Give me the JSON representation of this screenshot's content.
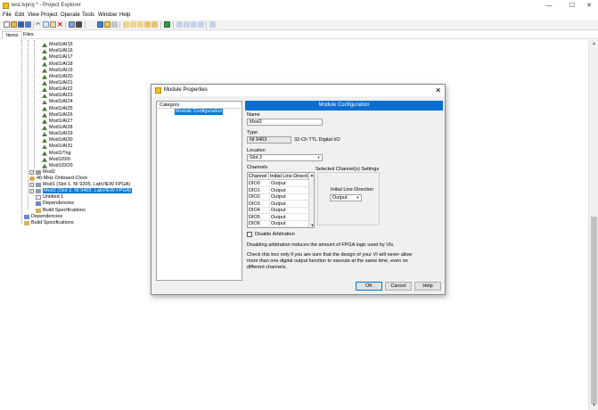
{
  "window": {
    "title": "test.lvproj * - Project Explorer",
    "minimize": "—",
    "maximize": "☐",
    "close": "✕"
  },
  "menu": [
    "File",
    "Edit",
    "View",
    "Project",
    "Operate",
    "Tools",
    "Window",
    "Help"
  ],
  "tabs": [
    "Items",
    "Files"
  ],
  "tree": {
    "channels": [
      "Mod1/AI15",
      "Mod1/AI16",
      "Mod1/AI17",
      "Mod1/AI18",
      "Mod1/AI19",
      "Mod1/AI20",
      "Mod1/AI21",
      "Mod1/AI22",
      "Mod1/AI23",
      "Mod1/AI24",
      "Mod1/AI25",
      "Mod1/AI26",
      "Mod1/AI27",
      "Mod1/AI28",
      "Mod1/AI29",
      "Mod1/AI30",
      "Mod1/AI31",
      "Mod1/Trig",
      "Mod1/DI0",
      "Mod1/DO0"
    ],
    "mod2": "Mod2",
    "clock": "40 MHz Onboard Clock",
    "mod1": "Mod1 (Slot 1, NI 9205, LabVIEW FPGA)",
    "mod2_selected": "Mod2 (Slot 2, NI 9403, LabVIEW FPGA)",
    "untitled": "Untitled 1",
    "dependencies": "Dependencies",
    "build_specs": "Build Specifications",
    "dependencies_root": "Dependencies",
    "build_specs_root": "Build Specifications"
  },
  "dialog": {
    "title": "Module Properties",
    "close": "✕",
    "category_header": "Category",
    "category_item": "Module Configuration",
    "section_title": "Module Configuration",
    "name_label": "Name",
    "name_value": "Mod2",
    "type_label": "Type",
    "type_value": "NI 9403",
    "type_desc": "32-Ch TTL Digital I/O",
    "location_label": "Location",
    "location_value": "Slot 2",
    "channels_label": "Channels",
    "selected_settings_label": "Selected Channel(s) Settings",
    "col_channel": "Channel",
    "col_direction": "Initial Line Direction",
    "channels": [
      {
        "name": "DIO0",
        "dir": "Output"
      },
      {
        "name": "DIO1",
        "dir": "Output"
      },
      {
        "name": "DIO2",
        "dir": "Output"
      },
      {
        "name": "DIO3",
        "dir": "Output"
      },
      {
        "name": "DIO4",
        "dir": "Output"
      },
      {
        "name": "DIO5",
        "dir": "Output"
      },
      {
        "name": "DIO6",
        "dir": "Output"
      }
    ],
    "initial_dir_label": "Initial Line Direction",
    "initial_dir_value": "Output",
    "disable_arb_label": "Disable Arbitration",
    "note1": "Disabling arbitration reduces the amount of FPGA logic used by VIs.",
    "note2_line1": "Check this box only if you are sure that the design of your VI will never allow",
    "note2_line2": "more than one digital output function to execute at the same time, even on",
    "note2_line3": "different channels.",
    "ok": "OK",
    "cancel": "Cancel",
    "help": "Help"
  },
  "colors": {
    "accent": "#0078d7",
    "section": "#0a6fd0",
    "icon_yellow": "#f2c21b"
  }
}
